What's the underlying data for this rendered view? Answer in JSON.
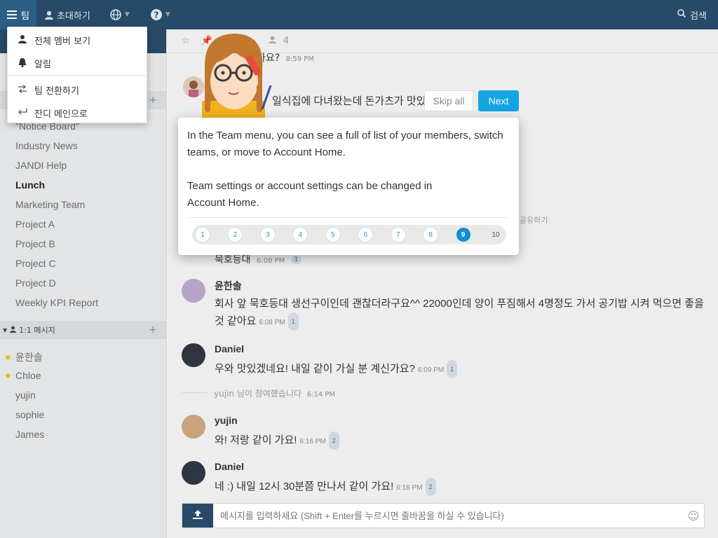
{
  "topbar": {
    "team_label": "팀",
    "invite_label": "초대하기",
    "search_label": "검색"
  },
  "dropdown": {
    "items": [
      {
        "label": "전체 멤버 보기",
        "icon": "members-icon"
      },
      {
        "label": "알림",
        "icon": "bell-icon"
      },
      {
        "label": "팀 전환하기",
        "icon": "switch-icon"
      },
      {
        "label": "잔디 메인으로",
        "icon": "return-icon"
      }
    ]
  },
  "sidebar": {
    "topics": [
      {
        "label": "\"Notice Board\"",
        "bold": false
      },
      {
        "label": "Industry News",
        "bold": false
      },
      {
        "label": "JANDI Help",
        "bold": false
      },
      {
        "label": "Lunch",
        "bold": true
      },
      {
        "label": "Marketing Team",
        "bold": false
      },
      {
        "label": "Project A",
        "bold": false
      },
      {
        "label": "Project B",
        "bold": false
      },
      {
        "label": "Project C",
        "bold": false
      },
      {
        "label": "Project D",
        "bold": false
      },
      {
        "label": "Weekly KPI Report",
        "bold": false
      }
    ],
    "dm_section_label": "1:1 메시지",
    "dms": [
      {
        "label": "윤한솔",
        "starred": true
      },
      {
        "label": "Chloe",
        "starred": true
      },
      {
        "label": "yujin",
        "starred": false
      },
      {
        "label": "sophie",
        "starred": false
      },
      {
        "label": "James",
        "starred": false
      }
    ]
  },
  "chat": {
    "header_member_count": "4",
    "partial_top": {
      "text": "가요?",
      "time": "8:59 PM"
    },
    "partial_msg2": {
      "text": "일식집에 다녀왔는데 돈가츠가 맛있"
    },
    "partial_share": "· 공유하기",
    "partial_msg3": {
      "text": "묵호등대",
      "time": "6:08 PM",
      "badge": "1"
    },
    "messages": [
      {
        "name": "윤한솔",
        "text": "회사 앞 묵호등대 생선구이인데 괜찮더라구요^^ 22000인데 양이 푸짐해서 4명정도 가서 공기밥 시켜 먹으면 좋을 것 같아요",
        "time": "6:08 PM",
        "badge": "1"
      },
      {
        "name": "Daniel",
        "text": "우와 맛있겠네요! 내일 같이 가실 분 계신가요?",
        "time": "6:09 PM",
        "badge": "1"
      },
      {
        "name": "yujin",
        "text": "와! 저랑 같이 가요!",
        "time": "6:16 PM",
        "badge": "2"
      },
      {
        "name": "Daniel",
        "text": "네 :) 내일 12시 30분쯤 만나서 같이 가요!",
        "time": "6:18 PM",
        "badge": "2"
      }
    ],
    "system": {
      "text": "yujin 님이 참여했습니다",
      "time": "6:14 PM"
    },
    "composer_placeholder": "메시지를 입력하세요 (Shift + Enter를 누르시면 줄바꿈을 하실 수 있습니다)"
  },
  "tour": {
    "line1": "In the Team menu, you can see a full of list of your members, switch teams, or move to Account Home.",
    "line2": "Team settings or account settings can be changed in Account Home.",
    "skip_label": "Skip all",
    "next_label": "Next",
    "steps": [
      "1",
      "2",
      "3",
      "4",
      "5",
      "6",
      "7",
      "8",
      "9",
      "10"
    ],
    "current_step": 9
  },
  "colors": {
    "topbar": "#264a68",
    "accent": "#14a4e3",
    "star": "#e8b400"
  }
}
